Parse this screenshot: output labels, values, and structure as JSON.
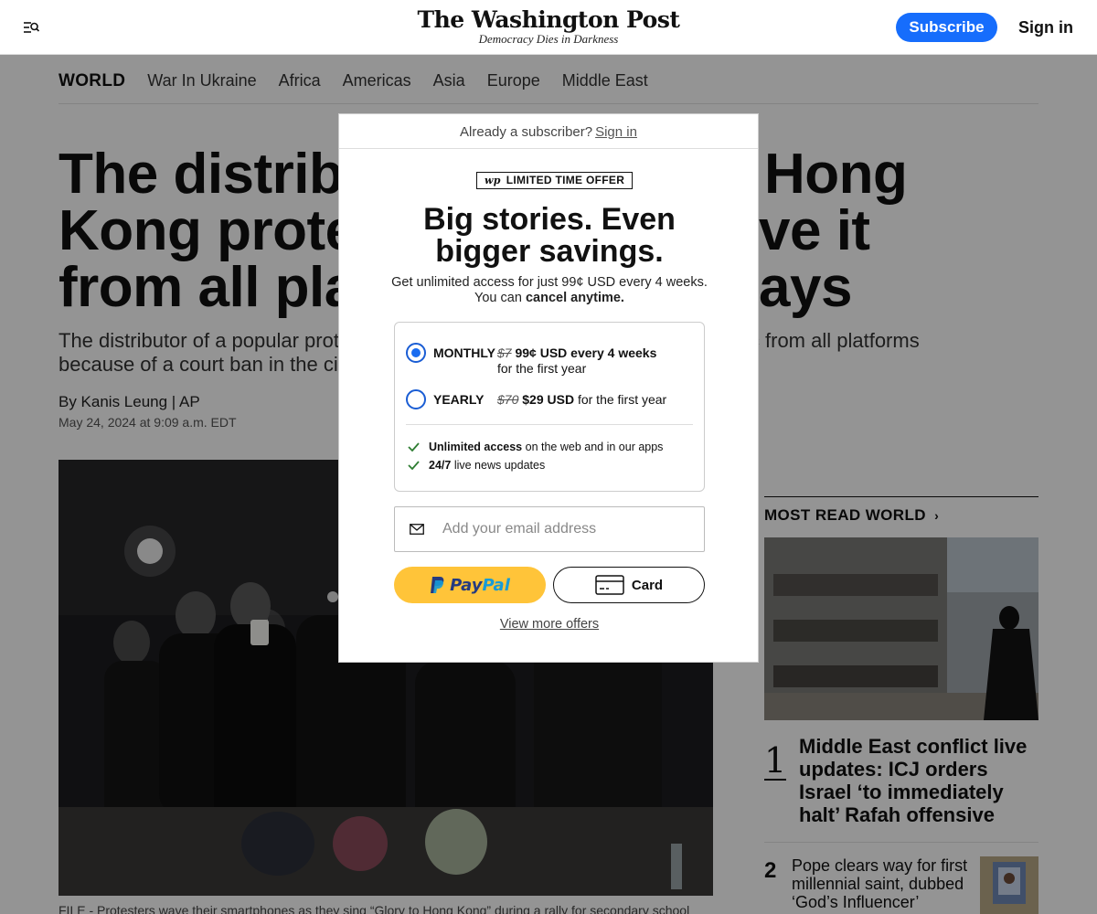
{
  "header": {
    "logo": "The Washington Post",
    "tagline": "Democracy Dies in Darkness",
    "subscribe": "Subscribe",
    "signin": "Sign in"
  },
  "nav": {
    "section": "WORLD",
    "items": [
      "War In Ukraine",
      "Africa",
      "Americas",
      "Asia",
      "Europe",
      "Middle East"
    ]
  },
  "article": {
    "headline_parts": [
      "The distribu",
      "Hong",
      "Kong protes",
      "ve it",
      "from all pla",
      "ays"
    ],
    "dek_part1": "The distributor of a popular protes",
    "dek_part2": "sic from all platforms",
    "dek_part3": "because of a court ban in the city, t",
    "byline": "By Kanis Leung | AP",
    "date": "May 24, 2024 at 9:09 a.m. EDT",
    "caption": "FILE - Protesters wave their smartphones as they sing “Glory to Hong Kong” during a rally for secondary school"
  },
  "sidebar": {
    "title": "MOST READ WORLD",
    "items": [
      {
        "num": "1",
        "text": "Middle East conflict live updates: ICJ orders Israel ‘to immediately halt’ Rafah offensive"
      },
      {
        "num": "2",
        "text": "Pope clears way for first millennial saint, dubbed ‘God’s Influencer’"
      }
    ]
  },
  "paywall": {
    "already": "Already a subscriber?",
    "signin_link": "Sign in",
    "tag": "LIMITED TIME OFFER",
    "tag_logo": "wp",
    "title_line1": "Big stories. Even",
    "title_line2": "bigger savings.",
    "sub_line1": "Get unlimited access for just 99¢ USD every 4 weeks.",
    "sub_line2_prefix": "You can",
    "sub_line2_bold": "cancel anytime.",
    "monthly": {
      "name": "MONTHLY",
      "old": "$7",
      "new": "99¢ USD every 4 weeks",
      "line2": "for the first year"
    },
    "yearly": {
      "name": "YEARLY",
      "old": "$70",
      "new": "$29 USD",
      "suffix": "for the first year"
    },
    "perk1_bold": "Unlimited access",
    "perk1_rest": "on the web and in our apps",
    "perk2_bold": "24/7",
    "perk2_rest": "live news updates",
    "email_placeholder": "Add your email address",
    "paypal_a": "Pay",
    "paypal_b": "Pal",
    "card": "Card",
    "more": "View more offers"
  },
  "colors": {
    "accent": "#166dfc",
    "paypal": "#ffc439",
    "check": "#2e7d32"
  }
}
